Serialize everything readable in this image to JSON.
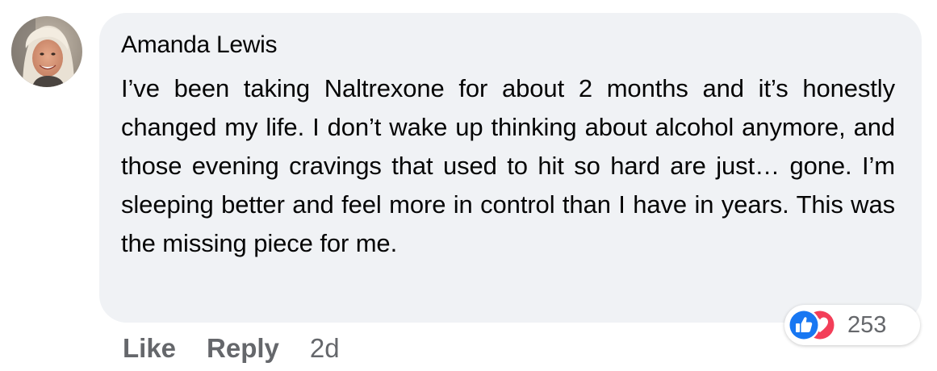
{
  "comment": {
    "author": "Amanda Lewis",
    "avatar_icon": "profile-photo",
    "text": "I’ve been taking Naltrexone for about 2 months and it’s honestly changed my life. I don’t wake up thinking about alcohol anymore, and those evening cravings that used to hit so hard are just… gone. I’m sleeping better and feel more in control than I have in years. This was the missing piece for me.",
    "reactions": {
      "icons": [
        "like-icon",
        "love-icon"
      ],
      "count": "253",
      "like_color": "#1877f2",
      "love_color": "#f33e58"
    },
    "actions": {
      "like_label": "Like",
      "reply_label": "Reply",
      "timestamp": "2d"
    }
  },
  "colors": {
    "bubble_bg": "#f0f2f5",
    "text": "#050505",
    "secondary_text": "#65676b"
  }
}
